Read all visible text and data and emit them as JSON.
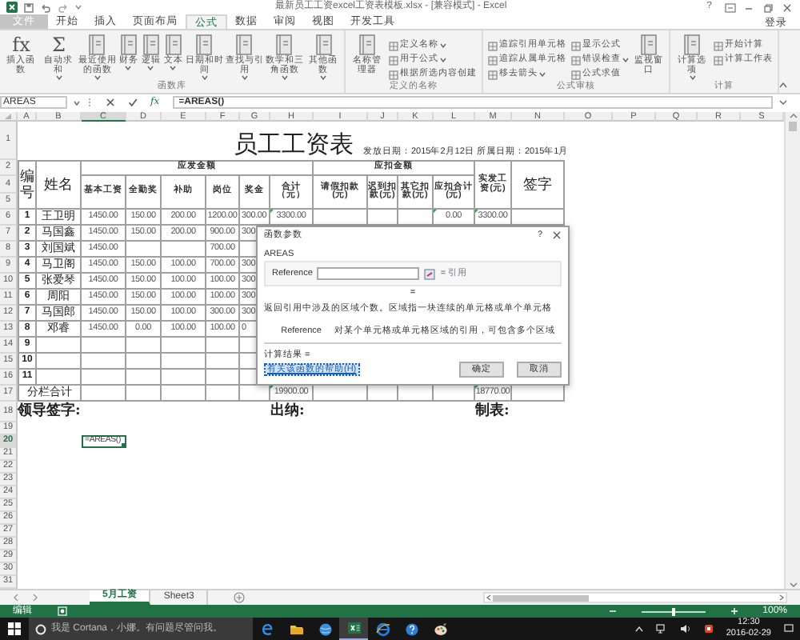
{
  "window": {
    "title": "最新员工工资excel工资表模板.xlsx - [兼容模式] - Excel",
    "help": "?"
  },
  "ribbon_tabs": [
    {
      "label": "文件",
      "selected": false,
      "kind": "file"
    },
    {
      "label": "开始",
      "selected": false,
      "kind": "tab"
    },
    {
      "label": "插入",
      "selected": false,
      "kind": "tab"
    },
    {
      "label": "页面布局",
      "selected": false,
      "kind": "tab"
    },
    {
      "label": "公式",
      "selected": true,
      "kind": "tab"
    },
    {
      "label": "数据",
      "selected": false,
      "kind": "tab"
    },
    {
      "label": "审阅",
      "selected": false,
      "kind": "tab"
    },
    {
      "label": "视图",
      "selected": false,
      "kind": "tab"
    },
    {
      "label": "开发工具",
      "selected": false,
      "kind": "tab"
    }
  ],
  "account": "登录",
  "ribbon_groups": [
    {
      "label": "函数库",
      "buttons": [
        {
          "label": "插入函数",
          "kind": "large",
          "icon": "fx",
          "dropdown": false
        },
        {
          "label": "自动求和",
          "kind": "large",
          "icon": "Σ",
          "dropdown": true
        },
        {
          "label": "最近使用的函数",
          "kind": "large",
          "dropdown": true
        },
        {
          "label": "财务",
          "kind": "large",
          "dropdown": true
        },
        {
          "label": "逻辑",
          "kind": "large",
          "dropdown": true
        },
        {
          "label": "文本",
          "kind": "large",
          "dropdown": true
        },
        {
          "label": "日期和时间",
          "kind": "large",
          "dropdown": true
        },
        {
          "label": "查找与引用",
          "kind": "large",
          "dropdown": true
        },
        {
          "label": "数学和三角函数",
          "kind": "large",
          "dropdown": true
        },
        {
          "label": "其他函数",
          "kind": "large",
          "dropdown": true
        }
      ]
    },
    {
      "label": "定义的名称",
      "buttons": [
        {
          "label": "名称管理器",
          "kind": "large",
          "dropdown": false
        },
        {
          "label": "定义名称",
          "kind": "small",
          "dropdown": true
        },
        {
          "label": "用于公式",
          "kind": "small",
          "dropdown": true
        },
        {
          "label": "根据所选内容创建",
          "kind": "small",
          "dropdown": false
        }
      ]
    },
    {
      "label": "公式审核",
      "buttons": [
        {
          "label": "追踪引用单元格",
          "kind": "small",
          "dropdown": false
        },
        {
          "label": "追踪从属单元格",
          "kind": "small",
          "dropdown": false
        },
        {
          "label": "移去箭头",
          "kind": "small",
          "dropdown": true
        },
        {
          "label": "显示公式",
          "kind": "small",
          "dropdown": false
        },
        {
          "label": "错误检查",
          "kind": "small",
          "dropdown": true
        },
        {
          "label": "公式求值",
          "kind": "small",
          "dropdown": false
        },
        {
          "label": "监视窗口",
          "kind": "large",
          "dropdown": false
        }
      ]
    },
    {
      "label": "计算",
      "buttons": [
        {
          "label": "计算选项",
          "kind": "large",
          "dropdown": true
        },
        {
          "label": "开始计算",
          "kind": "small",
          "dropdown": false
        },
        {
          "label": "计算工作表",
          "kind": "small",
          "dropdown": false
        }
      ]
    }
  ],
  "formula_bar": {
    "name_box": "AREAS",
    "fx": "fx",
    "formula": "=AREAS()"
  },
  "columns": [
    {
      "label": "A",
      "selected": false
    },
    {
      "label": "B",
      "selected": false
    },
    {
      "label": "C",
      "selected": true
    },
    {
      "label": "D",
      "selected": false
    },
    {
      "label": "E",
      "selected": false
    },
    {
      "label": "F",
      "selected": false
    },
    {
      "label": "G",
      "selected": false
    },
    {
      "label": "H",
      "selected": false
    },
    {
      "label": "I",
      "selected": false
    },
    {
      "label": "J",
      "selected": false
    },
    {
      "label": "K",
      "selected": false
    },
    {
      "label": "L",
      "selected": false
    },
    {
      "label": "M",
      "selected": false
    },
    {
      "label": "N",
      "selected": false
    },
    {
      "label": "O",
      "selected": false
    },
    {
      "label": "P",
      "selected": false
    },
    {
      "label": "Q",
      "selected": false
    },
    {
      "label": "R",
      "selected": false
    },
    {
      "label": "S",
      "selected": false
    }
  ],
  "row_numbers": [
    {
      "label": "1",
      "selected": false
    },
    {
      "label": "2",
      "selected": false
    },
    {
      "label": "4",
      "selected": false
    },
    {
      "label": "5",
      "selected": false
    },
    {
      "label": "6",
      "selected": false
    },
    {
      "label": "7",
      "selected": false
    },
    {
      "label": "8",
      "selected": false
    },
    {
      "label": "9",
      "selected": false
    },
    {
      "label": "10",
      "selected": false
    },
    {
      "label": "11",
      "selected": false
    },
    {
      "label": "12",
      "selected": false
    },
    {
      "label": "13",
      "selected": false
    },
    {
      "label": "14",
      "selected": false
    },
    {
      "label": "15",
      "selected": false
    },
    {
      "label": "16",
      "selected": false
    },
    {
      "label": "17",
      "selected": false
    },
    {
      "label": "18",
      "selected": false
    },
    {
      "label": "19",
      "selected": false
    },
    {
      "label": "20",
      "selected": true
    },
    {
      "label": "21",
      "selected": false
    },
    {
      "label": "22",
      "selected": false
    },
    {
      "label": "23",
      "selected": false
    },
    {
      "label": "24",
      "selected": false
    },
    {
      "label": "25",
      "selected": false
    },
    {
      "label": "26",
      "selected": false
    },
    {
      "label": "27",
      "selected": false
    },
    {
      "label": "28",
      "selected": false
    },
    {
      "label": "29",
      "selected": false
    },
    {
      "label": "30",
      "selected": false
    },
    {
      "label": "31",
      "selected": false
    }
  ],
  "sheet": {
    "title": "员工工资表",
    "date_info": "发放日期：2015年2月12日 所属日期：2015年1月",
    "header": {
      "no": "编号",
      "name": "姓名",
      "gross": {
        "label": "应发金额",
        "columns": [
          "基本工资",
          "全勤奖",
          "补助",
          "岗位",
          "奖金",
          "合计（元）"
        ]
      },
      "deduct": {
        "label": "应扣金额",
        "columns": [
          "请假扣款(元)",
          "迟到扣款(元)",
          "其它扣款(元)",
          "应扣合计(元)"
        ]
      },
      "net": "实发工资(元)",
      "sign": "签字"
    },
    "rows": [
      {
        "no": "1",
        "name": "王卫明",
        "amounts": {
          "basic": "1450.00",
          "attendance": "150.00",
          "allowance": "200.00",
          "post": "1200.00",
          "bonus": "300.00",
          "gross_total": {
            "text": "3300.00",
            "flagged": true
          },
          "deduct_total": {
            "text": "0.00",
            "flagged": true
          },
          "net": {
            "text": "3300.00",
            "flagged": true
          }
        }
      },
      {
        "no": "2",
        "name": "马国鑫",
        "amounts": {
          "basic": "1450.00",
          "attendance": "150.00",
          "allowance": "200.00",
          "post": "900.00",
          "bonus": "300"
        }
      },
      {
        "no": "3",
        "name": "刘国斌",
        "amounts": {
          "basic": "1450.00",
          "post": "700.00"
        }
      },
      {
        "no": "4",
        "name": "马卫阁",
        "amounts": {
          "basic": "1450.00",
          "attendance": "150.00",
          "allowance": "100.00",
          "post": "700.00",
          "bonus": "300"
        }
      },
      {
        "no": "5",
        "name": "张爱琴",
        "amounts": {
          "basic": "1450.00",
          "attendance": "150.00",
          "allowance": "100.00",
          "post": "100.00",
          "bonus": "300"
        }
      },
      {
        "no": "6",
        "name": "周阳",
        "amounts": {
          "basic": "1450.00",
          "attendance": "150.00",
          "allowance": "100.00",
          "post": "100.00",
          "bonus": "300"
        }
      },
      {
        "no": "7",
        "name": "马国郎",
        "amounts": {
          "basic": "1450.00",
          "attendance": "150.00",
          "allowance": "100.00",
          "post": "300.00",
          "bonus": "300"
        }
      },
      {
        "no": "8",
        "name": "邓睿",
        "amounts": {
          "basic": "1450.00",
          "attendance": "0.00",
          "allowance": "100.00",
          "post": "100.00",
          "bonus": "0"
        }
      },
      {
        "no": "9"
      },
      {
        "no": "10"
      },
      {
        "no": "11"
      }
    ],
    "total": {
      "label": "分栏合计",
      "amounts": {
        "gross_total": {
          "text": "19900.00",
          "flagged": true
        },
        "net": {
          "text": "18770.00",
          "flagged": true
        }
      }
    },
    "signatures": [
      "领导签字:",
      "出纳:",
      "制表:"
    ],
    "active_cell_text": "=AREAS()"
  },
  "dialog": {
    "title": "函数参数",
    "help": "?",
    "function_name": "AREAS",
    "argument": {
      "label": "Reference",
      "result": "= 引用"
    },
    "equals": "=",
    "description": "返回引用中涉及的区域个数。区域指一块连续的单元格或单个单元格",
    "argument_help": {
      "label": "Reference",
      "text": "对某个单元格或单元格区域的引用，可包含多个区域"
    },
    "result_label": "计算结果 =",
    "help_link": "有关该函数的帮助(H)",
    "buttons": [
      "确定",
      "取消"
    ]
  },
  "sheet_tabs": [
    {
      "label": "5月工资",
      "selected": true
    },
    {
      "label": "Sheet3",
      "selected": false
    }
  ],
  "status_bar": {
    "mode": "编辑",
    "zoom": {
      "level": 0.5,
      "reading": "100%"
    }
  },
  "taskbar": {
    "search_placeholder": "我是 Cortana，小娜。有问题尽管问我。",
    "apps": [
      {
        "active": false
      },
      {
        "active": false
      },
      {
        "active": false
      },
      {
        "active": true
      },
      {
        "active": false
      },
      {
        "active": false
      },
      {
        "active": false
      }
    ],
    "time": "12:30",
    "date": "2016-02-29"
  }
}
